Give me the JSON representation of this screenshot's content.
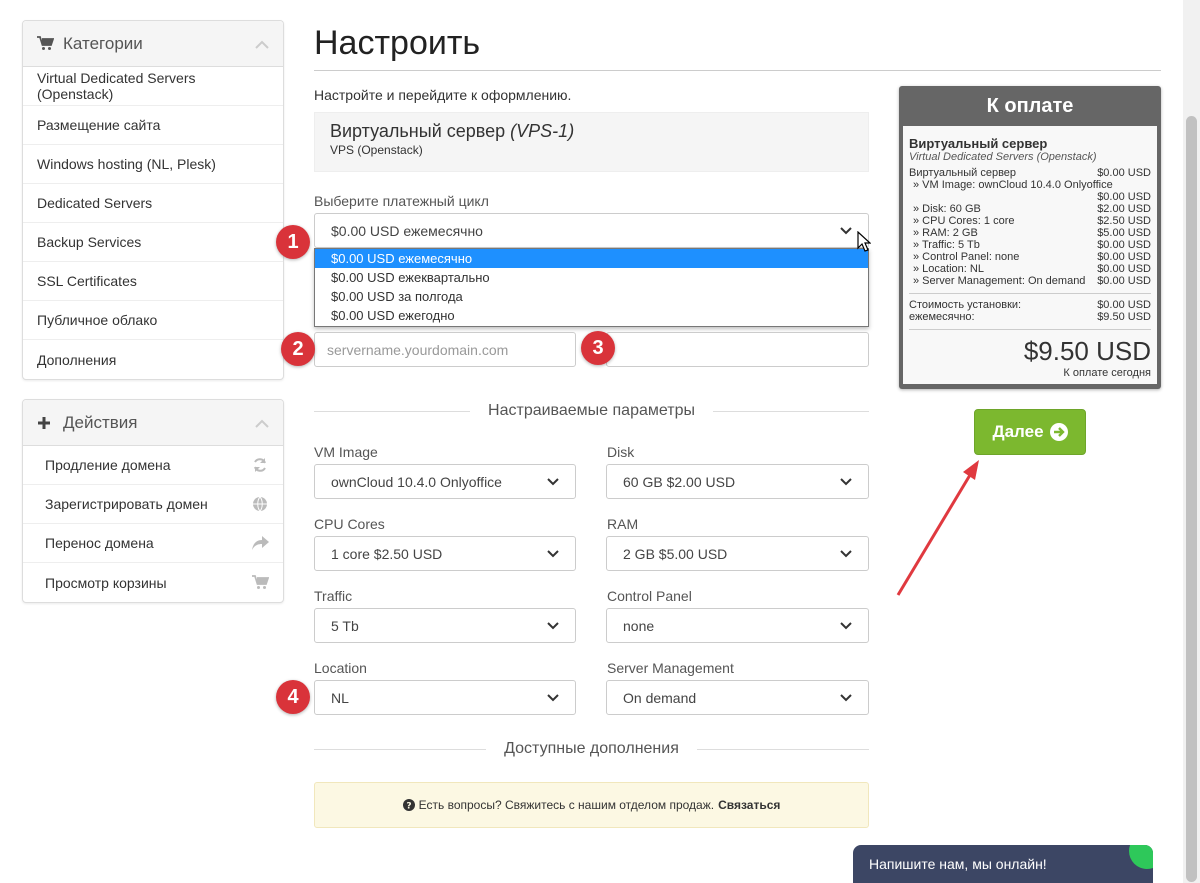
{
  "sidebar": {
    "categories": {
      "title": "Категории",
      "items": [
        {
          "label": "Virtual Dedicated Servers (Openstack)"
        },
        {
          "label": "Размещение сайта"
        },
        {
          "label": "Windows hosting (NL, Plesk)"
        },
        {
          "label": "Dedicated Servers"
        },
        {
          "label": "Backup Services"
        },
        {
          "label": "SSL Certificates"
        },
        {
          "label": "Публичное облако"
        },
        {
          "label": "Дополнения"
        }
      ]
    },
    "actions": {
      "title": "Действия",
      "items": [
        {
          "label": "Продление домена",
          "icon": "refresh-icon"
        },
        {
          "label": "Зарегистрировать домен",
          "icon": "globe-icon"
        },
        {
          "label": "Перенос домена",
          "icon": "share-arrow-icon"
        },
        {
          "label": "Просмотр корзины",
          "icon": "cart-icon"
        }
      ]
    }
  },
  "main": {
    "title": "Настроить",
    "intro": "Настройте и перейдите к оформлению.",
    "product": {
      "name": "Виртуальный сервер",
      "code": "(VPS-1)",
      "group": "VPS (Openstack)"
    },
    "billing": {
      "label": "Выберите платежный цикл",
      "selected": "$0.00 USD ежемесячно",
      "options": [
        "$0.00 USD ежемесячно",
        "$0.00 USD ежеквартально",
        "$0.00 USD за полгода",
        "$0.00 USD ежегодно"
      ]
    },
    "hostname_placeholder": "servername.yourdomain.com",
    "config_section_title": "Настраиваемые параметры",
    "options": {
      "vm_image": {
        "label": "VM Image",
        "value": "ownCloud 10.4.0 Onlyoffice"
      },
      "disk": {
        "label": "Disk",
        "value": "60 GB $2.00 USD"
      },
      "cpu": {
        "label": "CPU Cores",
        "value": "1 core $2.50 USD"
      },
      "ram": {
        "label": "RAM",
        "value": "2 GB $5.00 USD"
      },
      "traffic": {
        "label": "Traffic",
        "value": "5 Tb"
      },
      "control_panel": {
        "label": "Control Panel",
        "value": "none"
      },
      "location": {
        "label": "Location",
        "value": "NL"
      },
      "server_management": {
        "label": "Server Management",
        "value": "On demand"
      }
    },
    "addons_section_title": "Доступные дополнения",
    "help": {
      "text": "Есть вопросы? Свяжитесь с нашим отделом продаж.",
      "link": "Связаться"
    }
  },
  "badges": [
    "1",
    "2",
    "3",
    "4"
  ],
  "summary": {
    "header": "К оплате",
    "product_name": "Виртуальный сервер",
    "product_group": "Virtual Dedicated Servers (Openstack)",
    "base_label": "Виртуальный сервер",
    "base_price": "$0.00 USD",
    "lines": [
      {
        "label": "» VM Image: ownCloud 10.4.0 Onlyoffice",
        "price": "$0.00 USD"
      },
      {
        "label": "» Disk: 60 GB",
        "price": "$2.00 USD"
      },
      {
        "label": "» CPU Cores: 1 core",
        "price": "$2.50 USD"
      },
      {
        "label": "» RAM: 2 GB",
        "price": "$5.00 USD"
      },
      {
        "label": "» Traffic: 5 Tb",
        "price": "$0.00 USD"
      },
      {
        "label": "» Control Panel: none",
        "price": "$0.00 USD"
      },
      {
        "label": "» Location: NL",
        "price": "$0.00 USD"
      },
      {
        "label": "» Server Management: On demand",
        "price": "$0.00 USD"
      }
    ],
    "setup_label": "Стоимость установки:",
    "setup_price": "$0.00 USD",
    "monthly_label": "ежемесячно:",
    "monthly_price": "$9.50 USD",
    "total": "$9.50 USD",
    "total_caption": "К оплате сегодня"
  },
  "next_button": "Далее",
  "chat": {
    "text": "Напишите нам, мы онлайн!"
  },
  "colors": {
    "accent_green": "#7cb82f",
    "badge_red": "#d9333a",
    "select_blue": "#1e90ff",
    "summary_gray": "#666666",
    "chat_navy": "#3c4664"
  }
}
